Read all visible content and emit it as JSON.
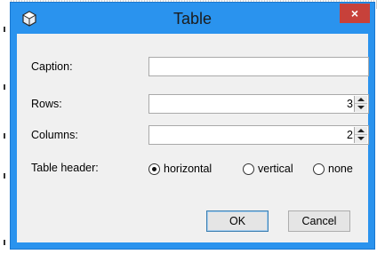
{
  "window": {
    "title": "Table",
    "close_label": "×"
  },
  "form": {
    "caption_label": "Caption:",
    "caption_value": "",
    "rows_label": "Rows:",
    "rows_value": "3",
    "columns_label": "Columns:",
    "columns_value": "2",
    "header_label": "Table header:",
    "header_options": [
      {
        "label": "horizontal",
        "selected": true
      },
      {
        "label": "vertical",
        "selected": false
      },
      {
        "label": "none",
        "selected": false
      }
    ]
  },
  "buttons": {
    "ok": "OK",
    "cancel": "Cancel"
  },
  "colors": {
    "titlebar": "#2a93ee",
    "close": "#c7413a"
  }
}
